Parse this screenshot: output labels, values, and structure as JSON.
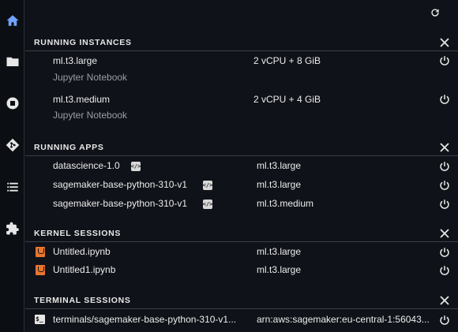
{
  "colors": {
    "accent": "#6fa3ff",
    "background": "#0f1218",
    "notebook_icon": "#e8752e"
  },
  "rail": {
    "items": [
      {
        "icon": "home-icon",
        "active": true
      },
      {
        "icon": "folder-icon",
        "active": false
      },
      {
        "icon": "stop-circle-icon",
        "active": false
      },
      {
        "icon": "git-icon",
        "active": false
      },
      {
        "icon": "list-icon",
        "active": false
      },
      {
        "icon": "extension-icon",
        "active": false
      }
    ]
  },
  "sections": {
    "instances": {
      "title": "RUNNING INSTANCES",
      "rows": [
        {
          "name": "ml.t3.large",
          "spec": "2 vCPU + 8 GiB",
          "sub": "Jupyter Notebook"
        },
        {
          "name": "ml.t3.medium",
          "spec": "2 vCPU + 4 GiB",
          "sub": "Jupyter Notebook"
        }
      ]
    },
    "apps": {
      "title": "RUNNING APPS",
      "rows": [
        {
          "name": "datascience-1.0",
          "instance": "ml.t3.large"
        },
        {
          "name": "sagemaker-base-python-310-v1",
          "instance": "ml.t3.large"
        },
        {
          "name": "sagemaker-base-python-310-v1",
          "instance": "ml.t3.medium"
        }
      ]
    },
    "kernels": {
      "title": "KERNEL SESSIONS",
      "rows": [
        {
          "name": "Untitled.ipynb",
          "instance": "ml.t3.large"
        },
        {
          "name": "Untitled1.ipynb",
          "instance": "ml.t3.large"
        }
      ]
    },
    "terminals": {
      "title": "TERMINAL SESSIONS",
      "rows": [
        {
          "name": "terminals/sagemaker-base-python-310-v1...",
          "arn": "arn:aws:sagemaker:eu-central-1:56043..."
        }
      ]
    }
  }
}
